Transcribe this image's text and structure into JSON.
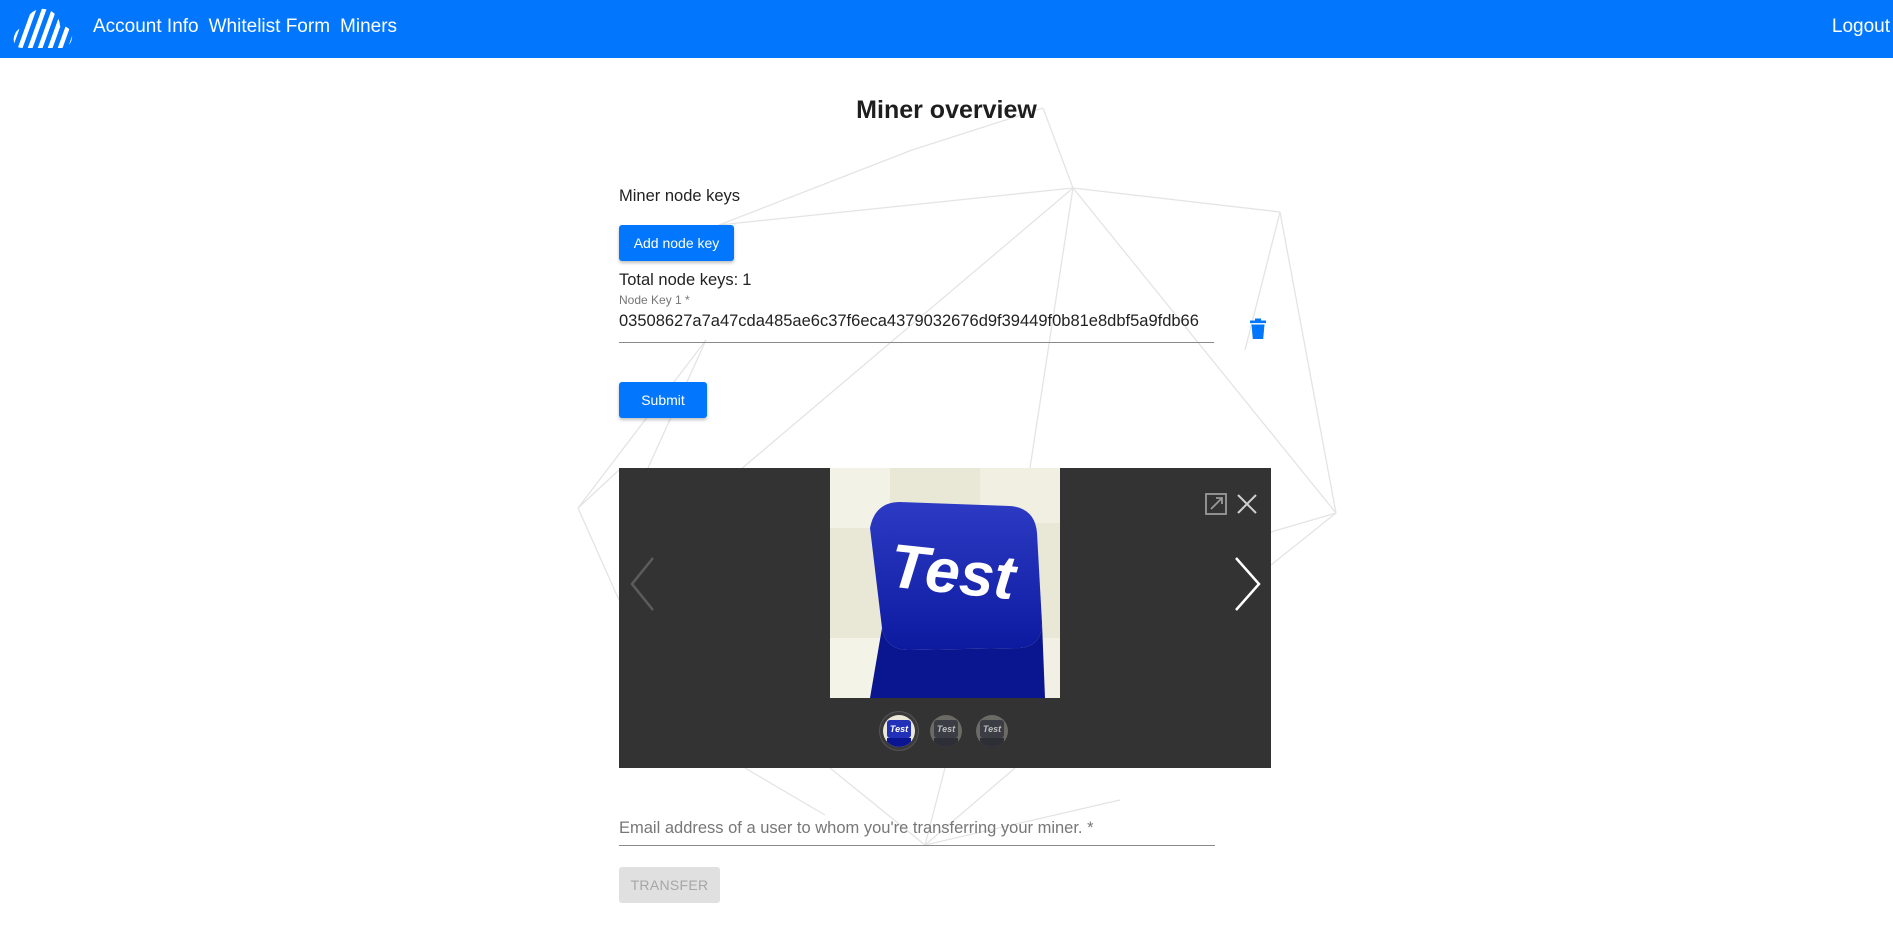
{
  "nav": {
    "links": [
      "Account Info",
      "Whitelist Form",
      "Miners"
    ],
    "logout": "Logout"
  },
  "page": {
    "title": "Miner overview"
  },
  "node_keys": {
    "section_label": "Miner node keys",
    "add_button": "Add node key",
    "total_label": "Total node keys:",
    "total_count": "1",
    "field_label": "Node Key 1 *",
    "field_value": "03508627a7a47cda485ae6c37f6eca4379032676d9f39449f0b81e8dbf5a9fdb66",
    "submit_button": "Submit"
  },
  "gallery": {
    "image_text": "Test",
    "thumbnail_count": 3,
    "active_thumbnail": 1
  },
  "transfer": {
    "email_placeholder": "Email address of a user to whom you're transferring your miner. *",
    "button": "TRANSFER"
  },
  "colors": {
    "brand": "#0277fe",
    "gallery_bg": "#333333",
    "disabled_bg": "#e0e0e0"
  }
}
